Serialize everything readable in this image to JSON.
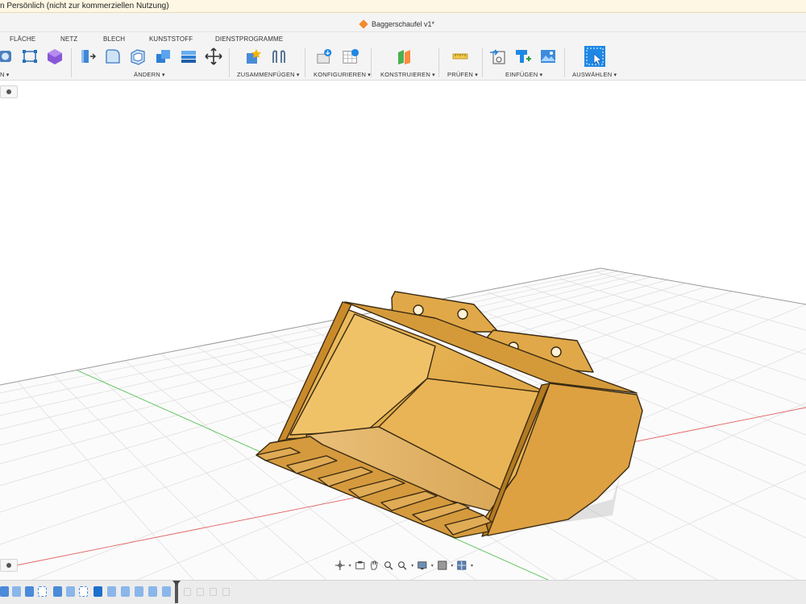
{
  "window": {
    "title_fragment": "n Persönlich (nicht zur kommerziellen Nutzung)"
  },
  "document": {
    "name": "Baggerschaufel v1*",
    "icon": "orange-cube-icon"
  },
  "ribbon": {
    "tabs": [
      "FLÄCHE",
      "NETZ",
      "BLECH",
      "KUNSTSTOFF",
      "DIENSTPROGRAMME"
    ],
    "groups": {
      "first": "N",
      "modify": "ÄNDERN",
      "assemble": "ZUSAMMENFÜGEN",
      "configure": "KONFIGURIEREN",
      "construct": "KONSTRUIEREN",
      "inspect": "PRÜFEN",
      "insert": "EINFÜGEN",
      "select": "AUSWÄHLEN"
    }
  },
  "colors": {
    "model_body": "#e8a93f",
    "model_shade": "#c98a2a",
    "accent_blue": "#1e88e5",
    "x_axis": "#e06060",
    "y_axis": "#58c058",
    "titlebar_bg": "#fdf7e3"
  },
  "navigation_bar": {
    "icons": [
      "orbit-icon",
      "look-at-icon",
      "pan-icon",
      "zoom-window-icon",
      "zoom-icon",
      "display-settings-icon",
      "visual-style-icon",
      "grid-icon"
    ]
  }
}
